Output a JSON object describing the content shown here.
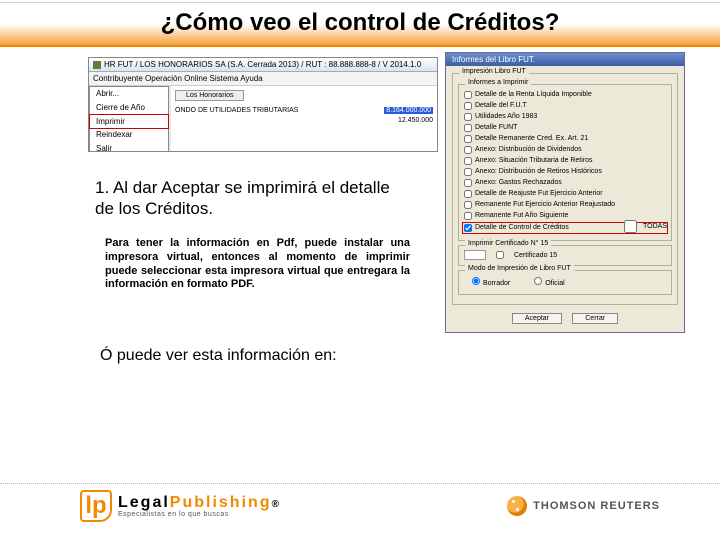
{
  "title": "¿Cómo veo el control de Créditos?",
  "app": {
    "titlebar": "HR FUT / LOS HONORARIOS SA   (S.A. Cerrada 2013) / RUT : 88.888.888-8 / V 2014.1.0",
    "menu": "Contribuyente   Operación Online   Sistema   Ayuda",
    "dropdown": {
      "abrir": "Abrir...",
      "cierre": "Cierre de Año",
      "imprimir": "Imprimir",
      "reindexar": "Reindexar",
      "salir": "Salir"
    },
    "tab": "Los Honorarios",
    "body_title": "ONDO DE UTILIDADES TRIBUTARIAS",
    "line2_label": "",
    "num1": "8.164.000.000",
    "num2": "12.450.000"
  },
  "dialog": {
    "title": "Informes del Libro FUT.",
    "section1": "Impresión Libro FUT",
    "legend_informes": "Informes a Imprimir",
    "items": [
      "Detalle de la Renta Líquida Imponible",
      "Detalle del F.U.T",
      "Utilidades Año 1983",
      "Detalle FUNT",
      "Detalle Remanente Cred. Ex. Art. 21",
      "Anexo: Distribución de Dividendos",
      "Anexo: Situación Tributaria de Retiros",
      "Anexo: Distribución de Retiros Históricos",
      "Anexo: Gastos Rechazados",
      "Detalle de Reajuste Fut Ejercicio Anterior",
      "Remanente Fut Ejercicio Anterior Reajustado",
      "Remanente Fut Año Siguiente",
      "Detalle de Control de Créditos"
    ],
    "todas": "TODAS",
    "legend_cert": "Imprimir Certificado N° 15",
    "cert_label": "Certificado 15",
    "legend_modo": "Modo de Impresión de Libro FUT",
    "radio_borrador": "Borrador",
    "radio_oficial": "Oficial",
    "btn_aceptar": "Aceptar",
    "btn_cerrar": "Cerrar"
  },
  "step1": "1. Al dar Aceptar se imprimirá el detalle de los  Créditos.",
  "note": "Para tener la información en Pdf, puede instalar una impresora virtual, entonces al momento de imprimir puede seleccionar esta impresora virtual que entregara la información en formato PDF.",
  "or_line": "Ó puede ver esta información en:",
  "footer": {
    "lp_brand": "LegalPublishing",
    "lp_tag": "Especialistas en lo que buscas",
    "tr": "THOMSON REUTERS"
  }
}
